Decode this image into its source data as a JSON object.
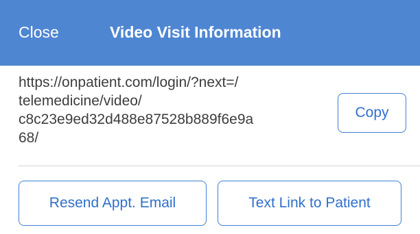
{
  "header": {
    "close_label": "Close",
    "title": "Video Visit Information"
  },
  "link": {
    "url_lines": [
      "https://onpatient.com/login/?next=/",
      "telemedicine/video/",
      "c8c23e9ed32d488e87528b889f6e9a",
      "68/"
    ],
    "copy_label": "Copy"
  },
  "actions": {
    "resend_label": "Resend Appt. Email",
    "text_link_label": "Text Link to Patient"
  },
  "colors": {
    "header_bg": "#4f86d2",
    "accent": "#2f6fcc"
  }
}
